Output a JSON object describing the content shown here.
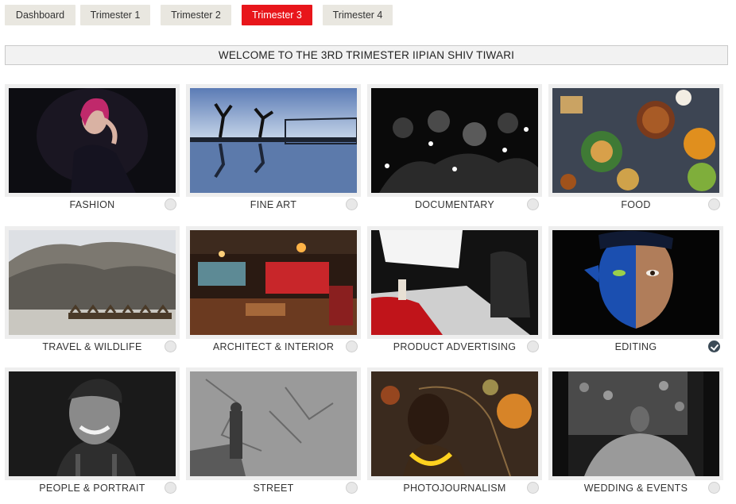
{
  "tabs": [
    {
      "label": "Dashboard",
      "active": false
    },
    {
      "label": "Trimester 1",
      "active": false
    },
    {
      "label": "Trimester 2",
      "active": false
    },
    {
      "label": "Trimester 3",
      "active": true
    },
    {
      "label": "Trimester 4",
      "active": false
    }
  ],
  "welcome_text": "WELCOME TO THE 3RD TRIMESTER IIPIAN SHIV TIWARI",
  "accent_color": "#e8161b",
  "check_color": "#3b4a56",
  "categories": [
    {
      "label": "FASHION",
      "selected": false
    },
    {
      "label": "FINE ART",
      "selected": false
    },
    {
      "label": "DOCUMENTARY",
      "selected": false
    },
    {
      "label": "FOOD",
      "selected": false
    },
    {
      "label": "TRAVEL & WILDLIFE",
      "selected": false
    },
    {
      "label": "ARCHITECT & INTERIOR",
      "selected": false
    },
    {
      "label": "PRODUCT ADVERTISING",
      "selected": false
    },
    {
      "label": "EDITING",
      "selected": true
    },
    {
      "label": "PEOPLE & PORTRAIT",
      "selected": false
    },
    {
      "label": "STREET",
      "selected": false
    },
    {
      "label": "PHOTOJOURNALISM",
      "selected": false
    },
    {
      "label": "WEDDING & EVENTS",
      "selected": false
    }
  ]
}
